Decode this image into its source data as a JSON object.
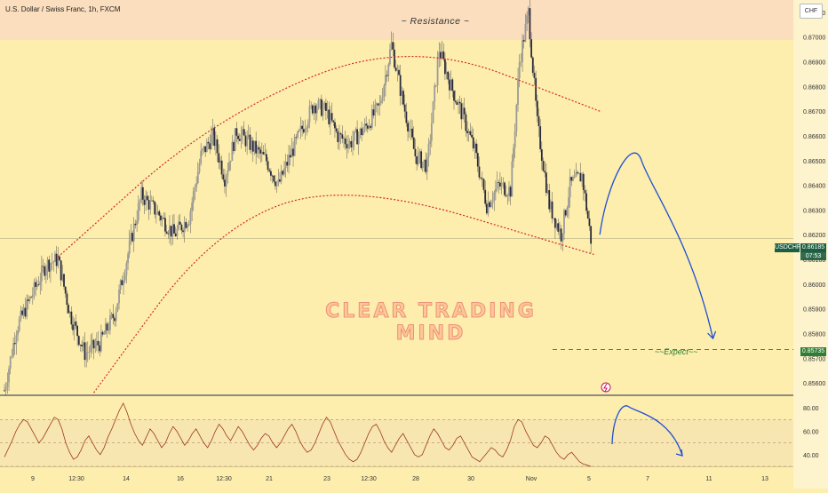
{
  "chart_data": [
    {
      "type": "candlestick",
      "title": "U.S. Dollar / Swiss Franc, 1h, FXCM",
      "symbol": "USDCHF",
      "currency": "CHF",
      "last_price": "0.86185",
      "countdown": "07:53",
      "annotations": {
        "resistance": "~ Resistance ~",
        "expect": "~~Expect~~",
        "expect_price": "0.85735",
        "watermark": "CLEAR TRADING MIND"
      },
      "ylim": [
        0.8555,
        0.8715
      ],
      "yticks": [
        "0.87100",
        "0.87000",
        "0.86900",
        "0.86800",
        "0.86700",
        "0.86600",
        "0.86500",
        "0.86400",
        "0.86300",
        "0.86200",
        "0.86100",
        "0.86000",
        "0.85900",
        "0.85800",
        "0.85700",
        "0.85600"
      ],
      "xticks": [
        "9",
        "12:30",
        "14",
        "16",
        "12:30",
        "21",
        "23",
        "12:30",
        "28",
        "30",
        "Nov",
        "5",
        "7",
        "11",
        "13"
      ],
      "price_path": [
        {
          "t": 0,
          "p": 0.8557
        },
        {
          "t": 4,
          "p": 0.8582
        },
        {
          "t": 9,
          "p": 0.8595
        },
        {
          "t": 14,
          "p": 0.8608
        },
        {
          "t": 18,
          "p": 0.861
        },
        {
          "t": 22,
          "p": 0.8588
        },
        {
          "t": 27,
          "p": 0.8572
        },
        {
          "t": 32,
          "p": 0.8576
        },
        {
          "t": 37,
          "p": 0.8588
        },
        {
          "t": 42,
          "p": 0.8615
        },
        {
          "t": 46,
          "p": 0.8636
        },
        {
          "t": 52,
          "p": 0.8628
        },
        {
          "t": 57,
          "p": 0.862
        },
        {
          "t": 62,
          "p": 0.8627
        },
        {
          "t": 66,
          "p": 0.8652
        },
        {
          "t": 70,
          "p": 0.866
        },
        {
          "t": 74,
          "p": 0.8643
        },
        {
          "t": 78,
          "p": 0.8662
        },
        {
          "t": 83,
          "p": 0.8656
        },
        {
          "t": 88,
          "p": 0.865
        },
        {
          "t": 92,
          "p": 0.864
        },
        {
          "t": 96,
          "p": 0.8652
        },
        {
          "t": 100,
          "p": 0.8663
        },
        {
          "t": 104,
          "p": 0.8673
        },
        {
          "t": 108,
          "p": 0.867
        },
        {
          "t": 112,
          "p": 0.866
        },
        {
          "t": 116,
          "p": 0.8657
        },
        {
          "t": 121,
          "p": 0.8663
        },
        {
          "t": 126,
          "p": 0.8672
        },
        {
          "t": 130,
          "p": 0.8697
        },
        {
          "t": 134,
          "p": 0.8673
        },
        {
          "t": 138,
          "p": 0.8652
        },
        {
          "t": 142,
          "p": 0.8648
        },
        {
          "t": 146,
          "p": 0.8695
        },
        {
          "t": 150,
          "p": 0.868
        },
        {
          "t": 154,
          "p": 0.8668
        },
        {
          "t": 158,
          "p": 0.8654
        },
        {
          "t": 162,
          "p": 0.8632
        },
        {
          "t": 166,
          "p": 0.864
        },
        {
          "t": 170,
          "p": 0.8638
        },
        {
          "t": 173,
          "p": 0.869
        },
        {
          "t": 176,
          "p": 0.871
        },
        {
          "t": 179,
          "p": 0.8665
        },
        {
          "t": 183,
          "p": 0.8632
        },
        {
          "t": 187,
          "p": 0.862
        },
        {
          "t": 190,
          "p": 0.864
        },
        {
          "t": 194,
          "p": 0.8644
        },
        {
          "t": 197,
          "p": 0.8618
        }
      ],
      "forecast_path": [
        {
          "t": 200,
          "p": 0.862
        },
        {
          "t": 214,
          "p": 0.865
        },
        {
          "t": 238,
          "p": 0.8578
        }
      ],
      "channel_upper_knots": [
        {
          "t": 18,
          "p": 0.8611
        },
        {
          "t": 70,
          "p": 0.8667
        },
        {
          "t": 135,
          "p": 0.87
        },
        {
          "t": 200,
          "p": 0.867
        }
      ],
      "channel_lower_knots": [
        {
          "t": 30,
          "p": 0.8556
        },
        {
          "t": 70,
          "p": 0.8622
        },
        {
          "t": 115,
          "p": 0.8642
        },
        {
          "t": 198,
          "p": 0.8612
        }
      ]
    },
    {
      "type": "line",
      "title": "",
      "ylim": [
        30,
        90
      ],
      "yticks": [
        "80.00",
        "60.00",
        "40.00"
      ],
      "overbought": 70,
      "oversold": 30,
      "midline": 50,
      "series": [
        {
          "values": [
            38,
            45,
            52,
            60,
            66,
            70,
            68,
            62,
            56,
            50,
            54,
            60,
            66,
            72,
            70,
            62,
            50,
            42,
            36,
            38,
            44,
            52,
            56,
            50,
            44,
            40,
            46,
            55,
            62,
            70,
            78,
            84,
            76,
            66,
            58,
            52,
            48,
            55,
            62,
            58,
            52,
            46,
            50,
            58,
            64,
            60,
            54,
            48,
            52,
            58,
            62,
            56,
            50,
            46,
            52,
            60,
            66,
            62,
            56,
            52,
            58,
            64,
            60,
            54,
            48,
            44,
            48,
            54,
            58,
            56,
            50,
            46,
            50,
            56,
            62,
            66,
            60,
            52,
            46,
            42,
            44,
            50,
            58,
            66,
            72,
            68,
            60,
            52,
            46,
            40,
            36,
            34,
            36,
            42,
            50,
            58,
            64,
            66,
            60,
            52,
            46,
            42,
            48,
            54,
            58,
            52,
            46,
            40,
            38,
            40,
            48,
            56,
            62,
            58,
            52,
            46,
            44,
            48,
            54,
            56,
            50,
            44,
            38,
            36,
            34,
            38,
            42,
            46,
            44,
            40,
            38,
            44,
            52,
            64,
            70,
            68,
            60,
            54,
            48,
            46,
            50,
            56,
            54,
            48,
            42,
            38,
            36,
            40,
            42,
            38,
            34,
            32,
            31,
            30
          ]
        }
      ]
    }
  ]
}
